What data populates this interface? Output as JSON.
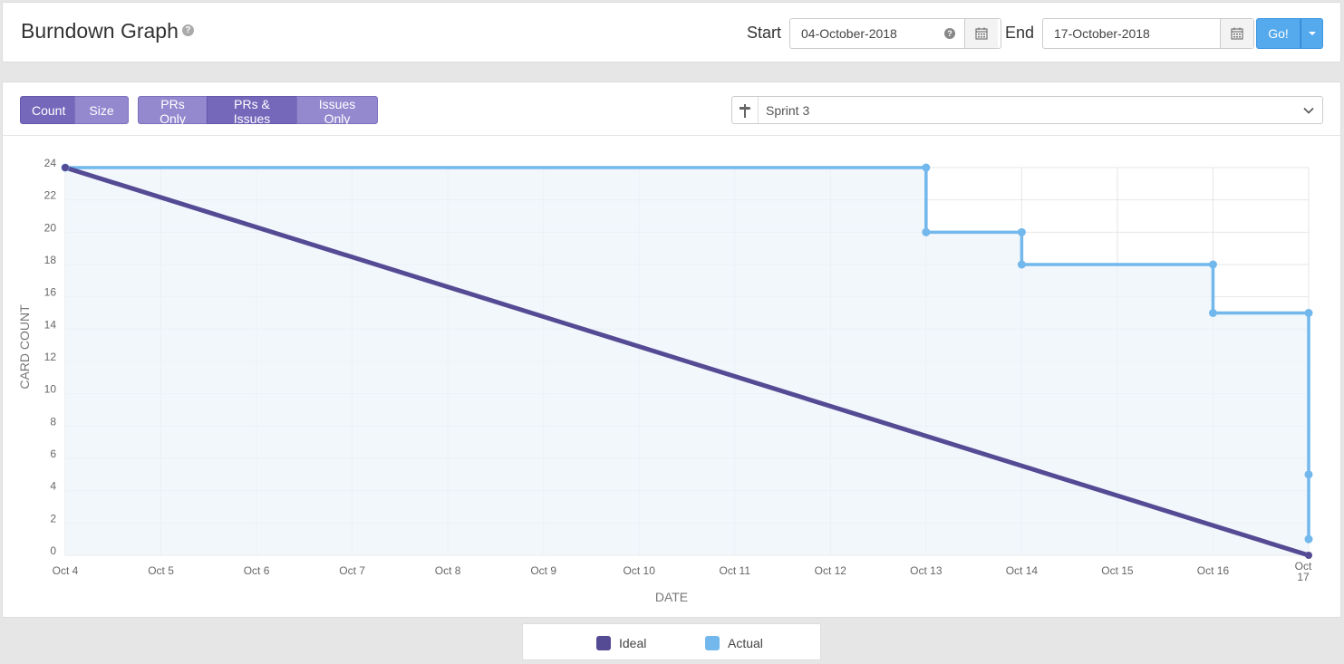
{
  "header": {
    "title": "Burndown Graph",
    "help_icon": "question-circle-icon",
    "start_label": "Start",
    "start_value": "04-October-2018",
    "end_label": "End",
    "end_value": "17-October-2018",
    "go_label": "Go!"
  },
  "toolbar": {
    "measure": [
      {
        "label": "Count",
        "active": true
      },
      {
        "label": "Size",
        "active": false
      }
    ],
    "filter": [
      {
        "label": "PRs Only",
        "active": false
      },
      {
        "label": "PRs & Issues",
        "active": true
      },
      {
        "label": "Issues Only",
        "active": false
      }
    ],
    "sprint_icon": "milestone-signpost-icon",
    "sprint_value": "Sprint 3"
  },
  "colors": {
    "ideal": "#544b94",
    "actual": "#72b8ec",
    "accent": "#55aaee",
    "toggle": "#9488cf",
    "toggle_active": "#7568bb"
  },
  "chart_data": {
    "type": "line",
    "xlabel": "DATE",
    "ylabel": "CARD COUNT",
    "ylim": [
      0,
      24
    ],
    "xlim": [
      "Oct 4",
      "Oct 17"
    ],
    "x_ticks": [
      "Oct 4",
      "Oct 5",
      "Oct 6",
      "Oct 7",
      "Oct 8",
      "Oct 9",
      "Oct 10",
      "Oct 11",
      "Oct 12",
      "Oct 13",
      "Oct 14",
      "Oct 15",
      "Oct 16",
      "Oct 17"
    ],
    "y_ticks": [
      0,
      2,
      4,
      6,
      8,
      10,
      12,
      14,
      16,
      18,
      20,
      22,
      24
    ],
    "grid": true,
    "legend_position": "bottom",
    "series": [
      {
        "name": "Ideal",
        "color": "#544b94",
        "points": [
          {
            "x": "Oct 4",
            "y": 24
          },
          {
            "x": "Oct 17",
            "y": 0
          }
        ]
      },
      {
        "name": "Actual",
        "color": "#72b8ec",
        "step": true,
        "fill": true,
        "points": [
          {
            "x": "Oct 4",
            "y": 24
          },
          {
            "x": "Oct 13",
            "y": 24
          },
          {
            "x": "Oct 13",
            "y": 20
          },
          {
            "x": "Oct 14",
            "y": 20
          },
          {
            "x": "Oct 14",
            "y": 18
          },
          {
            "x": "Oct 16",
            "y": 18
          },
          {
            "x": "Oct 16",
            "y": 15
          },
          {
            "x": "Oct 17",
            "y": 15
          },
          {
            "x": "Oct 17",
            "y": 5
          },
          {
            "x": "Oct 17",
            "y": 1
          }
        ]
      }
    ]
  },
  "legend": [
    {
      "label": "Ideal",
      "color": "#544b94"
    },
    {
      "label": "Actual",
      "color": "#72b8ec"
    }
  ]
}
